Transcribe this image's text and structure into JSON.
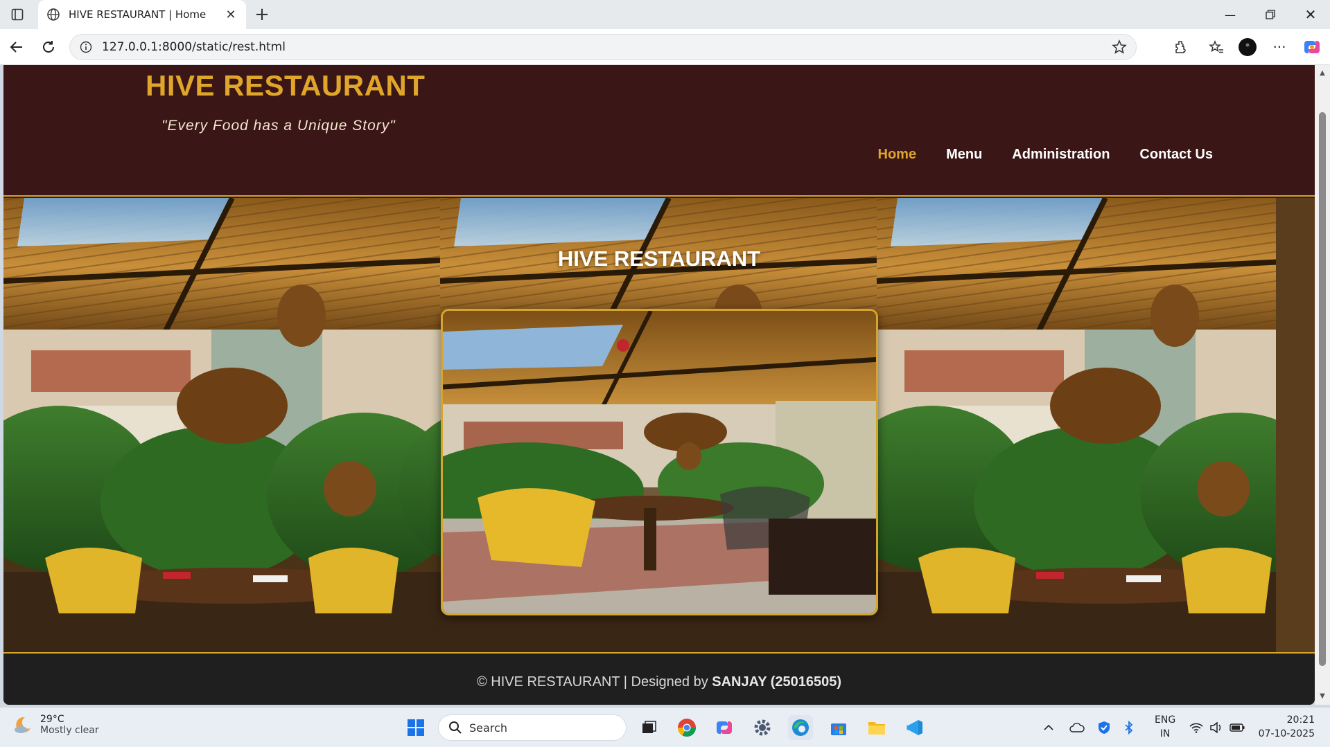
{
  "browser": {
    "tab_title": "HIVE RESTAURANT | Home",
    "url": "127.0.0.1:8000/static/rest.html"
  },
  "site": {
    "brand": "HIVE RESTAURANT",
    "tagline": "\"Every Food has a Unique Story\"",
    "nav": [
      {
        "label": "Home",
        "active": true
      },
      {
        "label": "Menu",
        "active": false
      },
      {
        "label": "Administration",
        "active": false
      },
      {
        "label": "Contact Us",
        "active": false
      }
    ],
    "hero_title": "HIVE RESTAURANT",
    "footer_prefix": "© HIVE RESTAURANT | Designed by ",
    "footer_author": "SANJAY (25016505)",
    "colors": {
      "accent": "#e0a62a",
      "header_bg": "#3a1616",
      "footer_bg": "#1f1f1f"
    }
  },
  "taskbar": {
    "weather_temp": "29°C",
    "weather_cond": "Mostly clear",
    "search_label": "Search",
    "lang_top": "ENG",
    "lang_bottom": "IN",
    "time": "20:21",
    "date": "07-10-2025"
  }
}
